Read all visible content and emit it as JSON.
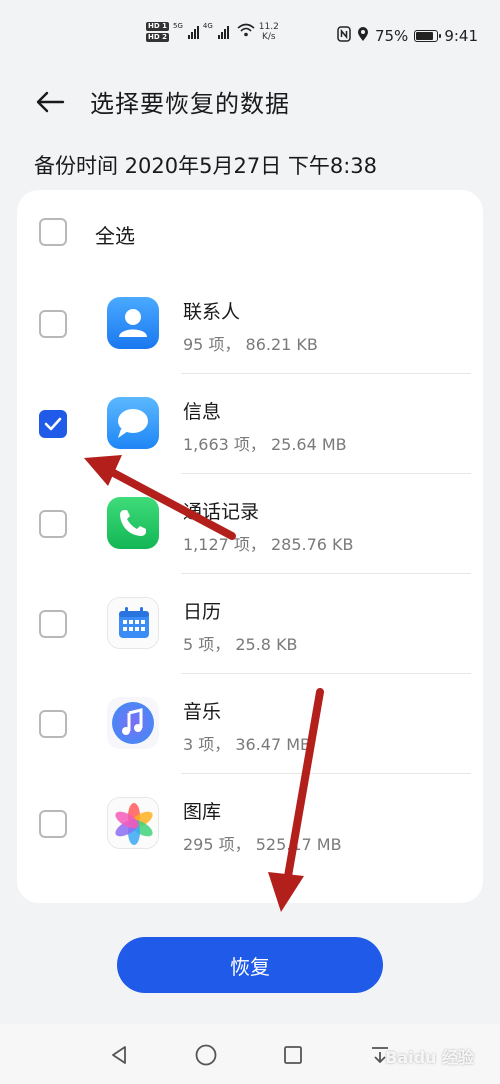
{
  "status_bar": {
    "hd1": "HD 1",
    "hd2": "HD 2",
    "net1": "5G",
    "net2": "4G",
    "speed_value": "11.2",
    "speed_unit": "K/s",
    "battery": "75%",
    "time": "9:41"
  },
  "header": {
    "title": "选择要恢复的数据"
  },
  "backup_time": "备份时间 2020年5月27日 下午8:38",
  "select_all": {
    "label": "全选",
    "checked": false
  },
  "items": [
    {
      "name": "联系人",
      "detail": "95 项， 86.21 KB",
      "checked": false,
      "icon": "contacts-icon"
    },
    {
      "name": "信息",
      "detail": "1,663 项， 25.64 MB",
      "checked": true,
      "icon": "messages-icon"
    },
    {
      "name": "通话记录",
      "detail": "1,127 项， 285.76 KB",
      "checked": false,
      "icon": "phone-icon"
    },
    {
      "name": "日历",
      "detail": "5 项， 25.8 KB",
      "checked": false,
      "icon": "calendar-icon"
    },
    {
      "name": "音乐",
      "detail": "3 项， 36.47 MB",
      "checked": false,
      "icon": "music-icon"
    },
    {
      "name": "图库",
      "detail": "295 项， 525.17 MB",
      "checked": false,
      "icon": "gallery-icon"
    }
  ],
  "restore_button": "恢复",
  "watermark": "Baidu 经验",
  "colors": {
    "accent": "#1f5ae8",
    "background": "#f1f3f5",
    "annotation_arrow": "#b3201c"
  }
}
